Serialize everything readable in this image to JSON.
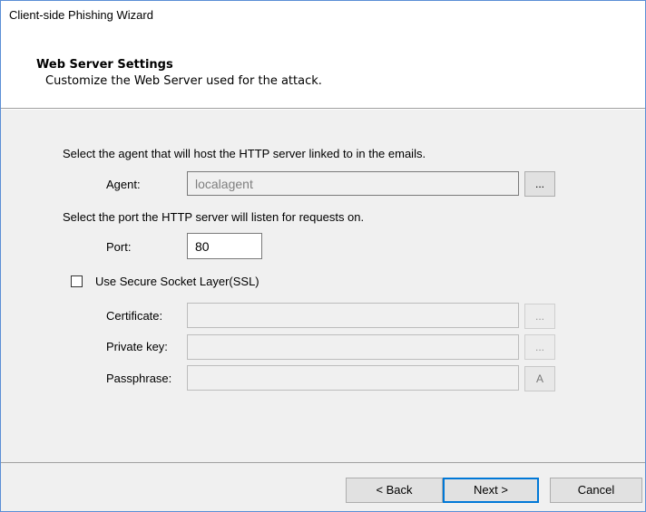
{
  "window": {
    "title": "Client-side Phishing Wizard"
  },
  "header": {
    "title": "Web Server Settings",
    "subtitle": "Customize the Web Server used for the attack."
  },
  "agent": {
    "instruction": "Select the agent that will host the HTTP server linked to in the emails.",
    "label": "Agent:",
    "value": "localagent",
    "browse_label": "..."
  },
  "port": {
    "instruction": "Select the port the HTTP server will listen for requests on.",
    "label": "Port:",
    "value": "80"
  },
  "ssl": {
    "checkbox_label": "Use Secure Socket Layer(SSL)",
    "checked": false,
    "certificate_label": "Certificate:",
    "certificate_value": "",
    "certificate_browse": "...",
    "private_key_label": "Private key:",
    "private_key_value": "",
    "private_key_browse": "...",
    "passphrase_label": "Passphrase:",
    "passphrase_value": "",
    "passphrase_button": "A"
  },
  "footer": {
    "back_label": "< Back",
    "next_label": "Next >",
    "cancel_label": "Cancel"
  }
}
